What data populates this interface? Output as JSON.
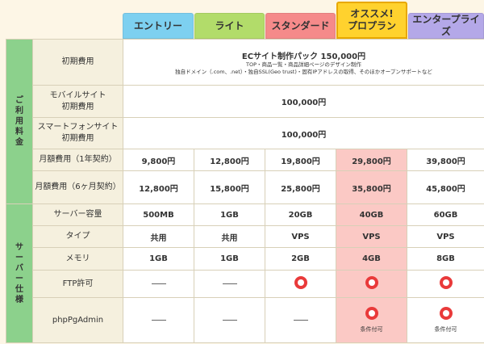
{
  "plans": [
    {
      "name": "エントリー",
      "color": "#7dd0f0"
    },
    {
      "name": "ライト",
      "color": "#b2dc6a"
    },
    {
      "name": "スタンダード",
      "color": "#f58a8a"
    },
    {
      "name": "オススメ!\nプロプラン",
      "color": "#ffd22e"
    },
    {
      "name": "エンタープライズ",
      "color": "#b4a8e8"
    }
  ],
  "sections": {
    "pricing": "ご利用料金",
    "server": "サーバー仕様"
  },
  "rows": {
    "initial_fee": {
      "label": "初期費用",
      "title": "ECサイト制作パック 150,000円",
      "line1": "TOP・商品一覧・商品詳細ページのデザイン制作",
      "line2": "独自ドメイン（.com、.net）・独自SSL(Geo trust)・固有IPアドレスの取得、そのほかオープンサポートなど"
    },
    "mobile_fee": {
      "label": "モバイルサイト\n初期費用",
      "value": "100,000円"
    },
    "smartphone_fee": {
      "label": "スマートフォンサイト\n初期費用",
      "value": "100,000円"
    },
    "monthly_1y": {
      "label": "月額費用（1年契約）",
      "values": [
        "9,800円",
        "12,800円",
        "19,800円",
        "29,800円",
        "39,800円"
      ]
    },
    "monthly_6m": {
      "label": "月額費用（6ヶ月契約）",
      "values": [
        "12,800円",
        "15,800円",
        "25,800円",
        "35,800円",
        "45,800円"
      ]
    },
    "capacity": {
      "label": "サーバー容量",
      "values": [
        "500MB",
        "1GB",
        "20GB",
        "40GB",
        "60GB"
      ]
    },
    "type": {
      "label": "タイプ",
      "values": [
        "共用",
        "共用",
        "VPS",
        "VPS",
        "VPS"
      ]
    },
    "memory": {
      "label": "メモリ",
      "values": [
        "1GB",
        "1GB",
        "2GB",
        "4GB",
        "8GB"
      ]
    },
    "ftp": {
      "label": "FTP許可",
      "values": [
        "dash",
        "dash",
        "circle",
        "circle",
        "circle"
      ]
    },
    "phppgadmin": {
      "label": "phpPgAdmin",
      "values": [
        "dash",
        "dash",
        "dash",
        "circle",
        "circle"
      ],
      "notes": [
        "",
        "",
        "",
        "条件付可",
        "条件付可"
      ]
    }
  },
  "highlight_color": "#fbc9c5"
}
